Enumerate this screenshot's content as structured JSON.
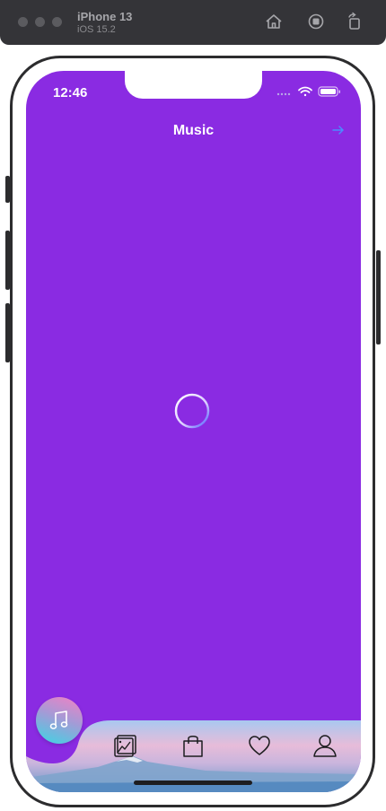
{
  "simulator": {
    "device_name": "iPhone 13",
    "os_version": "iOS 15.2",
    "buttons": [
      "home-icon",
      "screenshot-icon",
      "rotate-icon"
    ]
  },
  "status_bar": {
    "time": "12:46",
    "icons": [
      "signal-icon",
      "wifi-icon",
      "battery-icon"
    ]
  },
  "nav": {
    "title": "Music",
    "action_icon": "arrow-right-icon"
  },
  "content": {
    "loading": true,
    "spinner_icon": "spinner-icon"
  },
  "tab_bar": {
    "center_button_icon": "music-note-icon",
    "tabs": [
      {
        "icon": "photo-chart-icon"
      },
      {
        "icon": "shopping-bag-icon"
      },
      {
        "icon": "heart-icon"
      },
      {
        "icon": "user-icon"
      }
    ]
  },
  "colors": {
    "screen_bg": "#8a2be2",
    "accent": "#4a8cff",
    "fab_gradient": [
      "#f280c4",
      "#3ad6e4"
    ]
  }
}
